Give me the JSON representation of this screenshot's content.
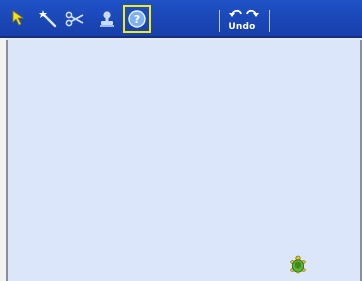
{
  "toolbar": {
    "tools": [
      {
        "icon": "arrow-pointer-icon"
      },
      {
        "icon": "magic-wand-icon"
      },
      {
        "icon": "scissors-icon"
      },
      {
        "icon": "stamp-icon"
      },
      {
        "icon": "help-icon",
        "selected": true
      }
    ],
    "undo_label": "Undo",
    "undo_icon": "undo-icon",
    "redo_icon": "redo-icon"
  },
  "canvas": {
    "sprite_icon": "turtle-icon"
  },
  "colors": {
    "toolbar": "#1a47b7",
    "canvas": "#dbe6fb",
    "selection_outline": "#f3ea1a",
    "turtle_shell": "#5cb531"
  }
}
